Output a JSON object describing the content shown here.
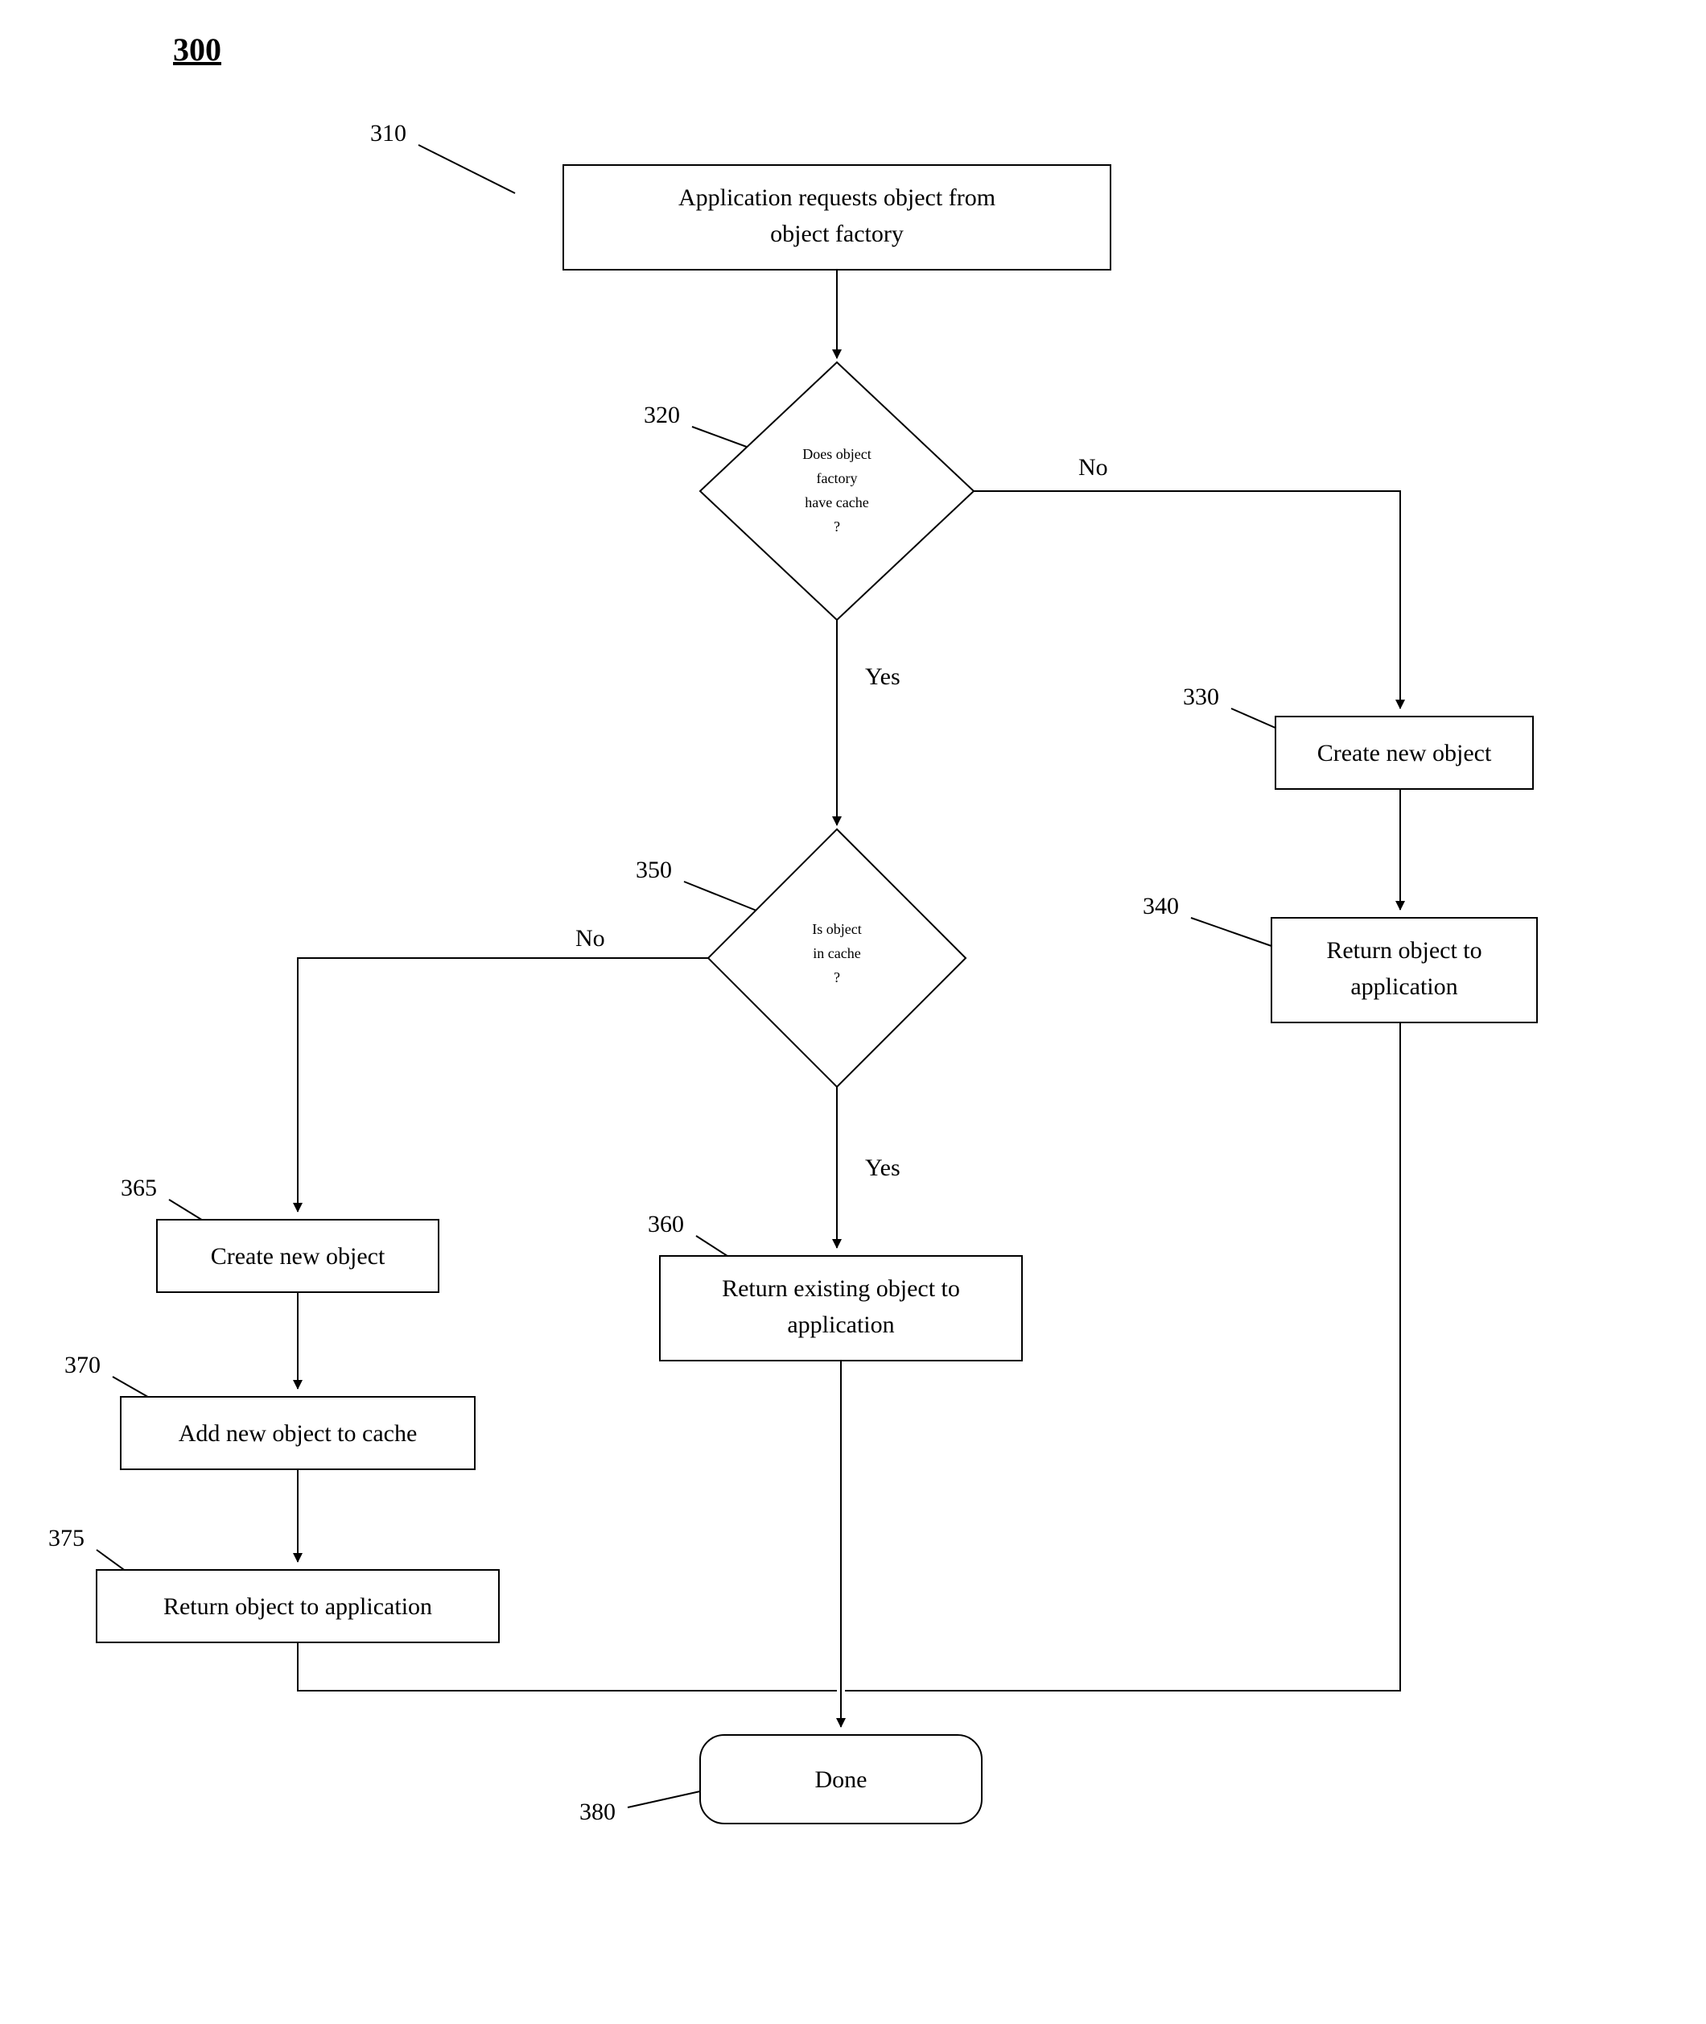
{
  "title": "300",
  "refs": {
    "r310": "310",
    "r320": "320",
    "r330": "330",
    "r340": "340",
    "r350": "350",
    "r360": "360",
    "r365": "365",
    "r370": "370",
    "r375": "375",
    "r380": "380"
  },
  "nodes": {
    "n310_l1": "Application requests object from",
    "n310_l2": "object factory",
    "n320_l1": "Does object",
    "n320_l2": "factory",
    "n320_l3": "have cache",
    "n320_l4": "?",
    "n330": "Create new object",
    "n340_l1": "Return object to",
    "n340_l2": "application",
    "n350_l1": "Is object",
    "n350_l2": "in cache",
    "n350_l3": "?",
    "n360_l1": "Return existing object to",
    "n360_l2": "application",
    "n365": "Create new object",
    "n370": "Add new object to cache",
    "n375": "Return object to application",
    "n380": "Done"
  },
  "edges": {
    "no": "No",
    "yes": "Yes"
  }
}
